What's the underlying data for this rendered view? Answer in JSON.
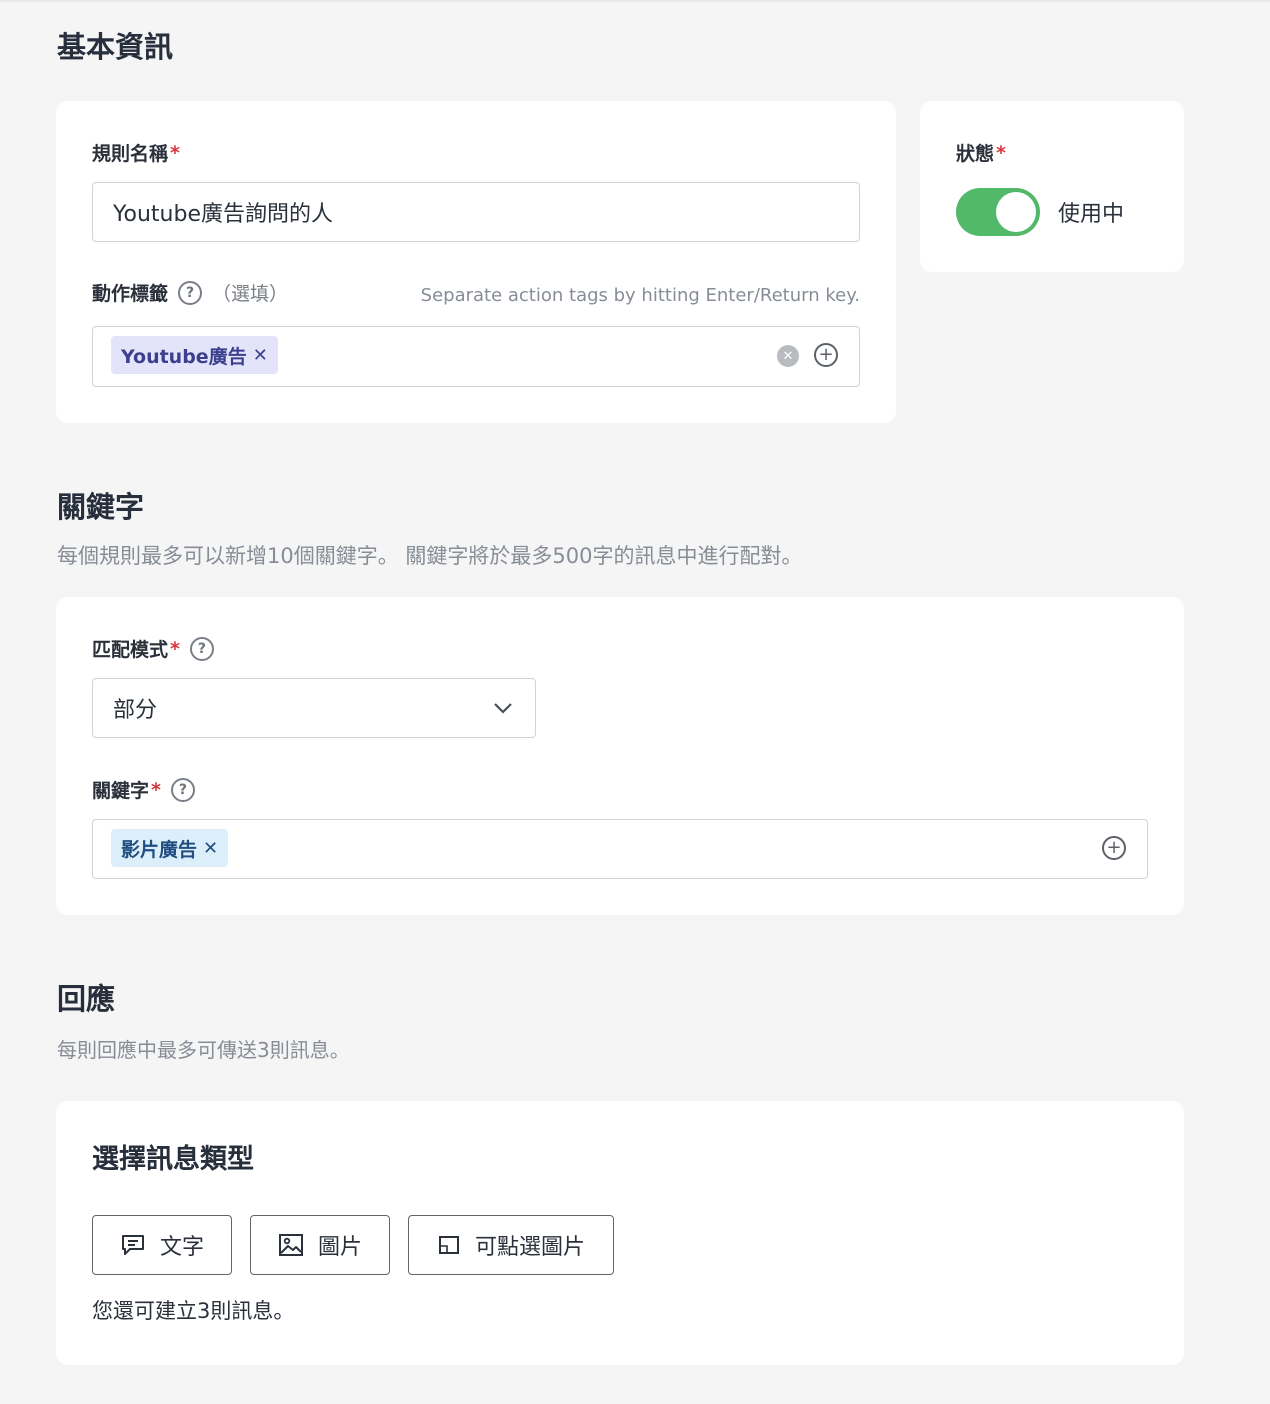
{
  "basic_info": {
    "title": "基本資訊",
    "rule_name": {
      "label": "規則名稱",
      "required_mark": "*",
      "value": "Youtube廣告詢問的人"
    },
    "action_tags": {
      "label": "動作標籤",
      "help_icon": "question-circle-icon",
      "optional": "（選填）",
      "hint": "Separate action tags by hitting Enter/Return key.",
      "tags": [
        {
          "label": "Youtube廣告",
          "remove": "✕"
        }
      ],
      "clear_icon": "clear-circle-icon",
      "add_icon": "plus-circle-icon"
    },
    "status": {
      "label": "狀態",
      "required_mark": "*",
      "enabled": true,
      "state_text": "使用中",
      "color": "#52b86a"
    }
  },
  "keywords": {
    "title": "關鍵字",
    "description": "每個規則最多可以新增10個關鍵字。 關鍵字將於最多500字的訊息中進行配對。",
    "match_mode": {
      "label": "匹配模式",
      "required_mark": "*",
      "help": "?",
      "selected": "部分"
    },
    "keyword_field": {
      "label": "關鍵字",
      "required_mark": "*",
      "help": "?",
      "tags": [
        {
          "label": "影片廣告",
          "remove": "✕"
        }
      ],
      "add_icon": "plus-circle-icon"
    }
  },
  "response": {
    "title": "回應",
    "description": "每則回應中最多可傳送3則訊息。",
    "card_title": "選擇訊息類型",
    "buttons": [
      {
        "label": "文字",
        "icon": "chat-bubble-icon"
      },
      {
        "label": "圖片",
        "icon": "image-icon"
      },
      {
        "label": "可點選圖片",
        "icon": "tap-image-icon"
      }
    ],
    "remaining": "您還可建立3則訊息。"
  }
}
